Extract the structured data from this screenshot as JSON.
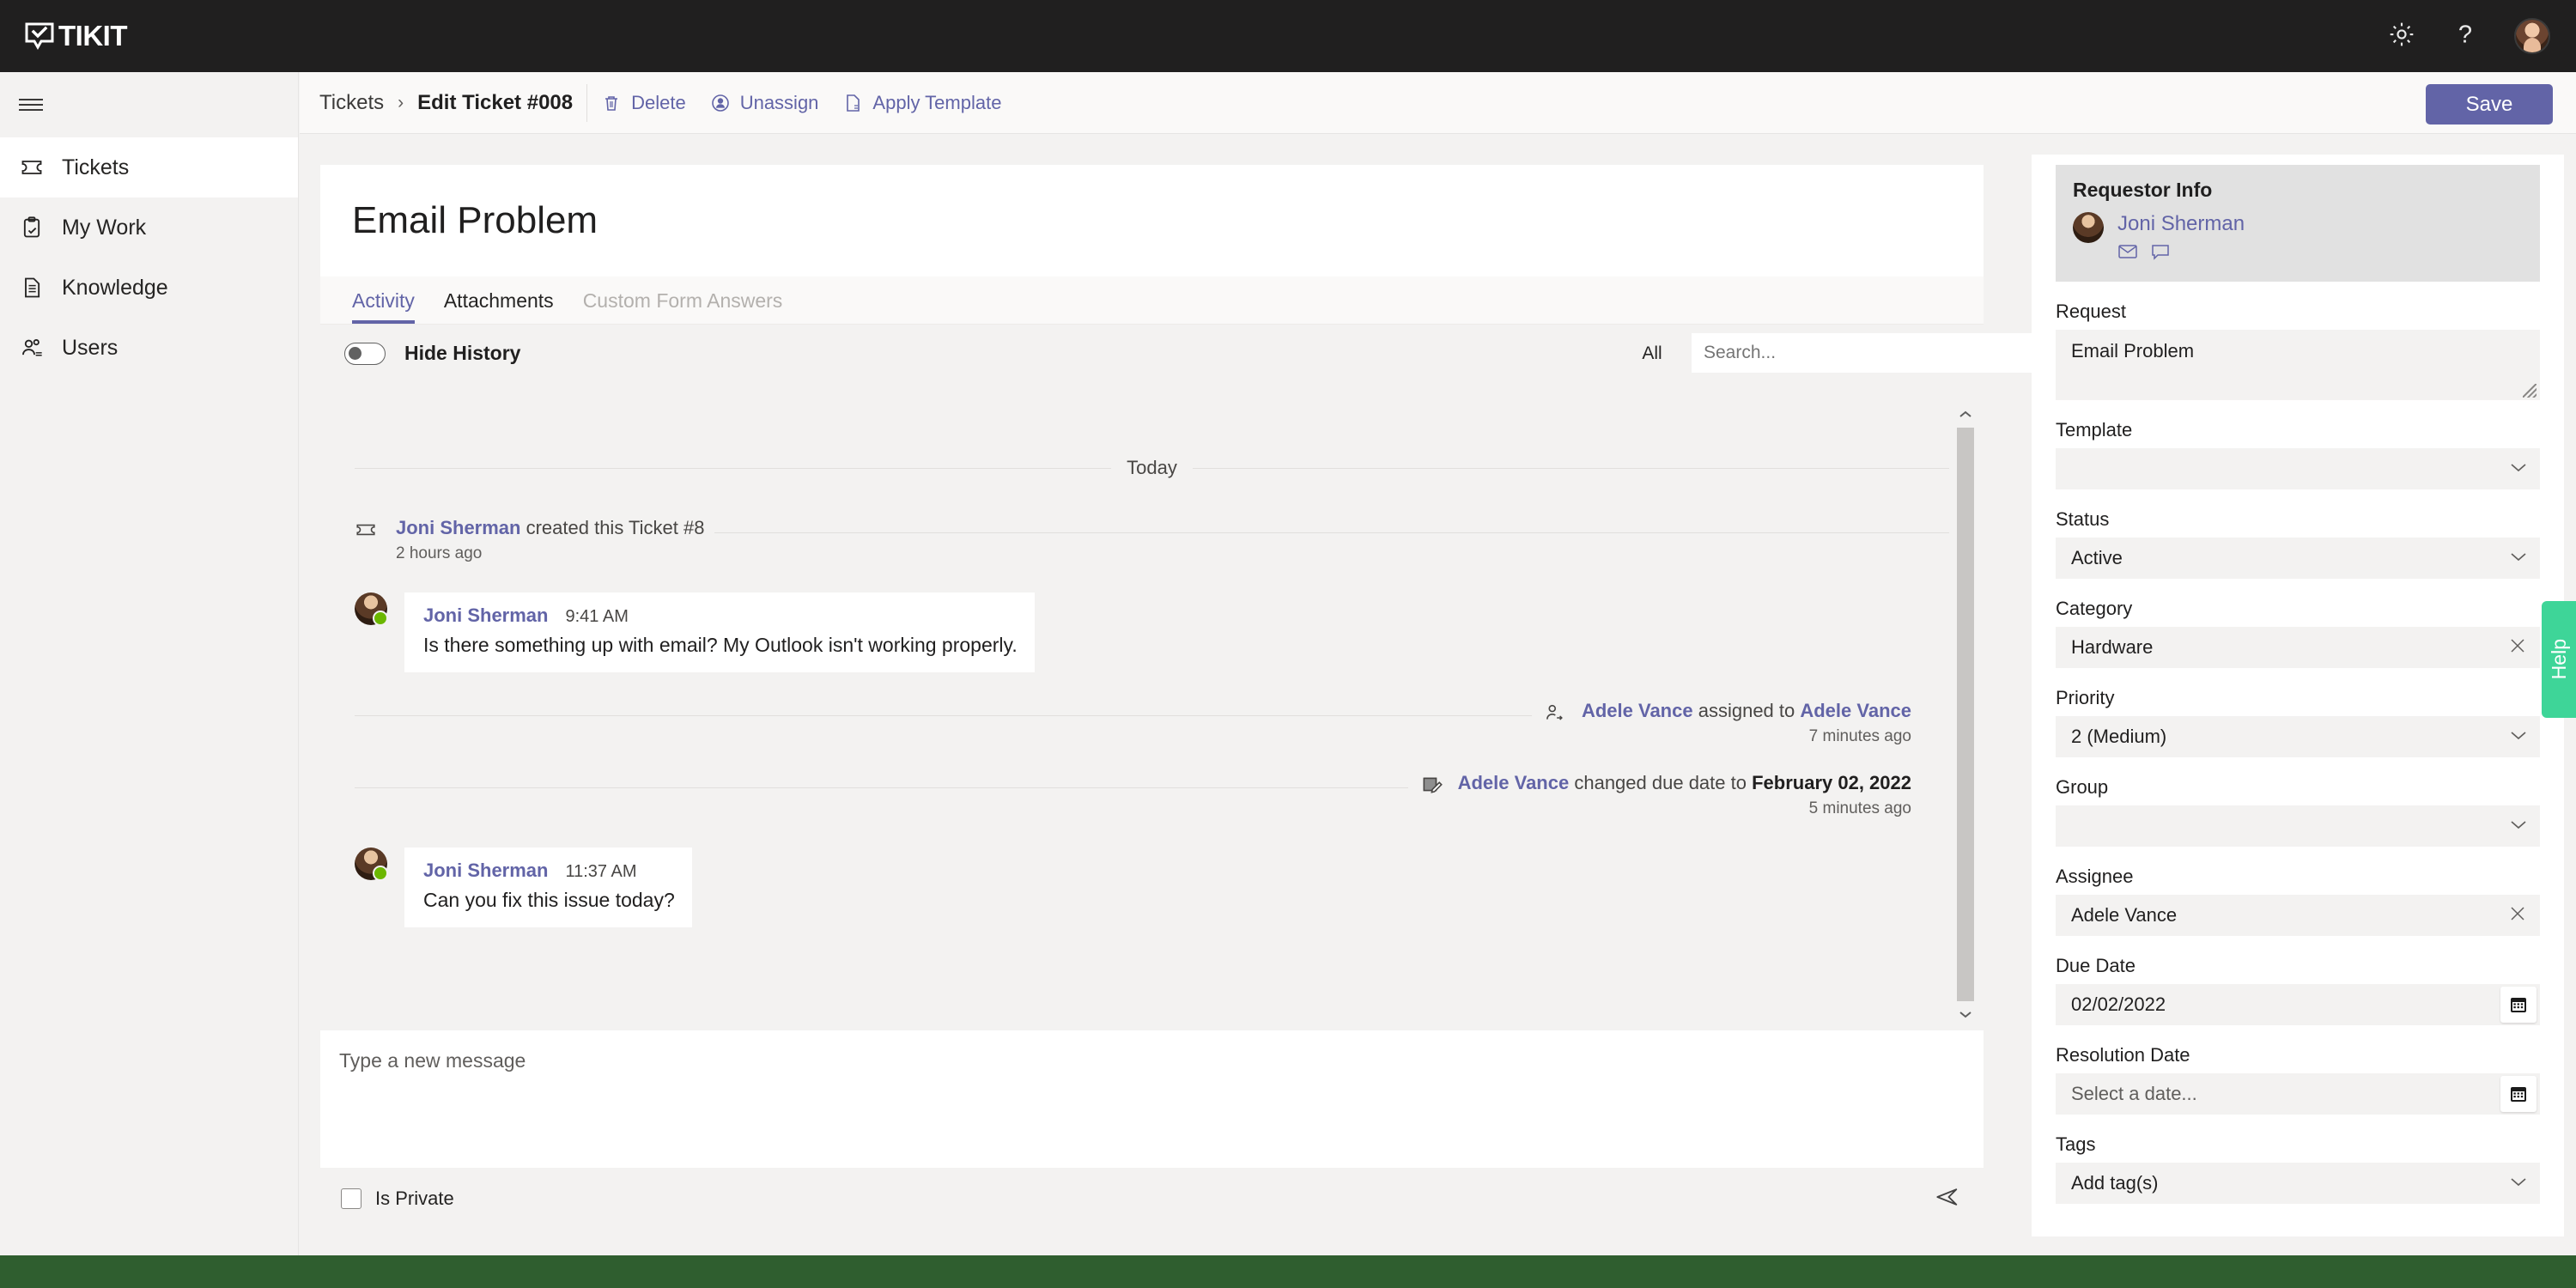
{
  "app": {
    "logo_text": "TIKIT",
    "logo_icon": "speech-bubble-check-icon",
    "gear_icon": "gear-icon",
    "help_icon": "question-mark-icon",
    "avatar_icon": "user-avatar"
  },
  "sidebar": {
    "menu_icon": "hamburger-menu-icon",
    "items": [
      {
        "label": "Tickets",
        "icon": "ticket-icon",
        "active": true
      },
      {
        "label": "My Work",
        "icon": "clipboard-check-icon",
        "active": false
      },
      {
        "label": "Knowledge",
        "icon": "document-icon",
        "active": false
      },
      {
        "label": "Users",
        "icon": "people-icon",
        "active": false
      }
    ]
  },
  "commandbar": {
    "breadcrumb_root": "Tickets",
    "breadcrumb_sep": "›",
    "breadcrumb_current": "Edit Ticket #008",
    "actions": [
      {
        "label": "Delete",
        "icon": "trash-icon"
      },
      {
        "label": "Unassign",
        "icon": "person-circle-icon"
      },
      {
        "label": "Apply Template",
        "icon": "template-document-icon"
      }
    ],
    "save_label": "Save"
  },
  "ticket": {
    "title": "Email Problem",
    "tabs": [
      {
        "label": "Activity",
        "state": "active"
      },
      {
        "label": "Attachments",
        "state": "normal"
      },
      {
        "label": "Custom Form Answers",
        "state": "disabled"
      }
    ],
    "hide_history_label": "Hide History",
    "hide_history_on": false,
    "filter_label": "All",
    "search_placeholder": "Search...",
    "search_value": "",
    "search_icon": "search-icon"
  },
  "feed": {
    "day_divider": "Today",
    "events": [
      {
        "kind": "system-left",
        "icon": "ticket-icon",
        "actor": "Joni Sherman",
        "text": " created this Ticket #8",
        "time": "2 hours ago"
      },
      {
        "kind": "message",
        "author": "Joni Sherman",
        "time": "9:41 AM",
        "body": "Is there something up with email? My Outlook isn't working properly.",
        "presence": "available"
      },
      {
        "kind": "system-right",
        "icon": "person-assign-icon",
        "actor": "Adele Vance",
        "middle": " assigned to ",
        "target": "Adele Vance",
        "time": "7 minutes ago"
      },
      {
        "kind": "system-right",
        "icon": "edit-note-icon",
        "actor": "Adele Vance",
        "middle": " changed due date to ",
        "target": "February 02, 2022",
        "time": "5 minutes ago"
      },
      {
        "kind": "message",
        "author": "Joni Sherman",
        "time": "11:37 AM",
        "body": "Can you fix this issue today?",
        "presence": "available"
      }
    ],
    "scroll_up_icon": "chevron-up-icon",
    "scroll_down_icon": "chevron-down-icon"
  },
  "composer": {
    "placeholder": "Type a new message",
    "value": "",
    "is_private_label": "Is Private",
    "is_private_checked": false,
    "send_icon": "send-icon"
  },
  "right_panel": {
    "requestor": {
      "title": "Requestor Info",
      "name": "Joni Sherman",
      "email_icon": "envelope-icon",
      "chat_icon": "chat-bubble-icon"
    },
    "fields": [
      {
        "label": "Request",
        "value": "Email Problem",
        "type": "textarea"
      },
      {
        "label": "Template",
        "value": "",
        "type": "select",
        "placeholder": ""
      },
      {
        "label": "Status",
        "value": "Active",
        "type": "select"
      },
      {
        "label": "Category",
        "value": "Hardware",
        "type": "clearable"
      },
      {
        "label": "Priority",
        "value": "2 (Medium)",
        "type": "select"
      },
      {
        "label": "Group",
        "value": "",
        "type": "select"
      },
      {
        "label": "Assignee",
        "value": "Adele Vance",
        "type": "clearable"
      },
      {
        "label": "Due Date",
        "value": "02/02/2022",
        "type": "date"
      },
      {
        "label": "Resolution Date",
        "value": "Select a date...",
        "type": "date",
        "is_placeholder": true
      },
      {
        "label": "Tags",
        "value": "Add tag(s)",
        "type": "select",
        "is_placeholder": true
      }
    ],
    "help_tab_label": "Help",
    "help_tab_color": "#3ed598"
  },
  "colors": {
    "brand_purple": "#6264a7",
    "topbar_dark": "#201f1f",
    "page_bg": "#f3f2f1",
    "presence_green": "#6bb700",
    "bottom_bar_green": "#2f5e2f"
  }
}
